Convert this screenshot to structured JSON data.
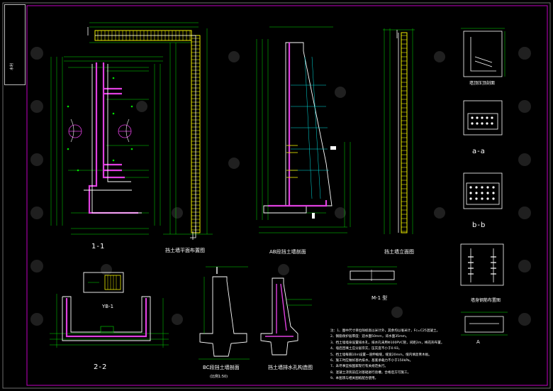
{
  "title_block": {
    "label": "水利"
  },
  "views": {
    "v11": "1-1",
    "plan": "挡土墙平面布置图",
    "ab": "AB段挡土墙剖面",
    "elev": "挡土墙立面图",
    "tb1": "YB-1",
    "v22": "2-2",
    "bc": "BC段挡土墙剖面",
    "bc_sub": "(比例1:50)",
    "detail": "挡土墙排水孔构造图",
    "m1": "M-1 型",
    "waterstop": "墙顶压顶剖面",
    "aa": "a-a",
    "bb": "b-b",
    "rebar": "墙身钢筋布置图",
    "A": "A"
  },
  "notes": [
    "注：1、图中尺寸单位除标高以米计外，其余均以毫米计，Fc=C25混凝土。",
    "2、钢筋保护层厚度：迎水面50mm，背水面35mm。",
    "3、挡土墙墙身设置排水孔，排水孔采用Φ100PVC管，间距2m，梅花形布置。",
    "4、墙后回填土应分层夯实，压实度不小于0.93。",
    "5、挡土墙每隔10m设置一道伸缩缝，缝宽20mm，缝内填沥青木板。",
    "6、施工时应做好基坑排水，基底承载力不小于150kPa。",
    "7、未尽事宜按国家现行有关规范执行。",
    "8、混凝土浇筑前应对基础进行验槽，合格后方可施工。",
    "9、本图须与相关图纸配合使用。"
  ],
  "colors": {
    "frame": "#c000c0",
    "dim": "#00e000",
    "wall": "#e040e0",
    "rebar": "#f0f000",
    "line": "#ffffff"
  }
}
